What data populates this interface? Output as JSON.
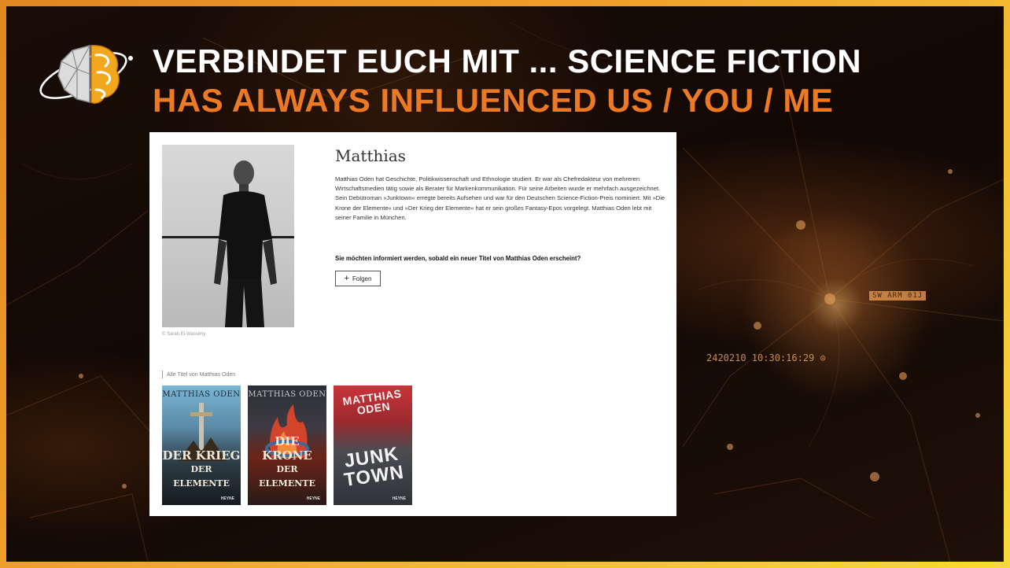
{
  "slide": {
    "title_line1": "VERBINDET EUCH MIT ... SCIENCE FICTION",
    "title_line2": "HAS ALWAYS INFLUENCED US  / YOU / ME",
    "title_color_primary": "#ffffff",
    "title_color_accent": "#ec7a24",
    "frame_colors": [
      "#e2861f",
      "#f7d93a"
    ],
    "logo_icon": "brain-orbit-icon"
  },
  "profile": {
    "name": "Matthias",
    "bio": "Matthias Oden hat Geschichte, Politikwissenschaft und Ethnologie studiert. Er war als Chefredakteur von mehreren Wirtschaftsmedien tätig sowie als Berater für Markenkommunikation. Für seine Arbeiten wurde er mehrfach ausgezeichnet. Sein Debütroman »Junktown« erregte bereits Aufsehen und war für den Deutschen Science-Fiction-Preis nominiert. Mit »Die Krone der Elemente« und »Der Krieg der Elemente« hat er sein großes Fantasy-Epos vorgelegt. Matthias Oden lebt mit seiner Familie in München.",
    "photo_credit": "© Sarah El-Wassimy",
    "follow_prompt": "Sie möchten informiert werden, sobald ein neuer Titel von Matthias Oden erscheint?",
    "follow_button": "Folgen",
    "follow_icon": "plus-icon"
  },
  "titles_section": {
    "label": "Alle Titel von Matthias Oden",
    "books": [
      {
        "author": "MATTHIAS ODEN",
        "title_a": "DER KRIEG",
        "title_b": "DER ELEMENTE",
        "publisher": "HEYNE"
      },
      {
        "author": "MATTHIAS ODEN",
        "title_a": "DIE KRONE",
        "title_b": "DER ELEMENTE",
        "publisher": "HEYNE"
      },
      {
        "author": "MATTHIAS ODEN",
        "title_a": "JUNK",
        "title_b": "TOWN",
        "publisher": "HEYNE"
      }
    ]
  },
  "background_hud": {
    "tag": "SW ARM 01J",
    "readout": "2420210      10:30:16:29"
  }
}
